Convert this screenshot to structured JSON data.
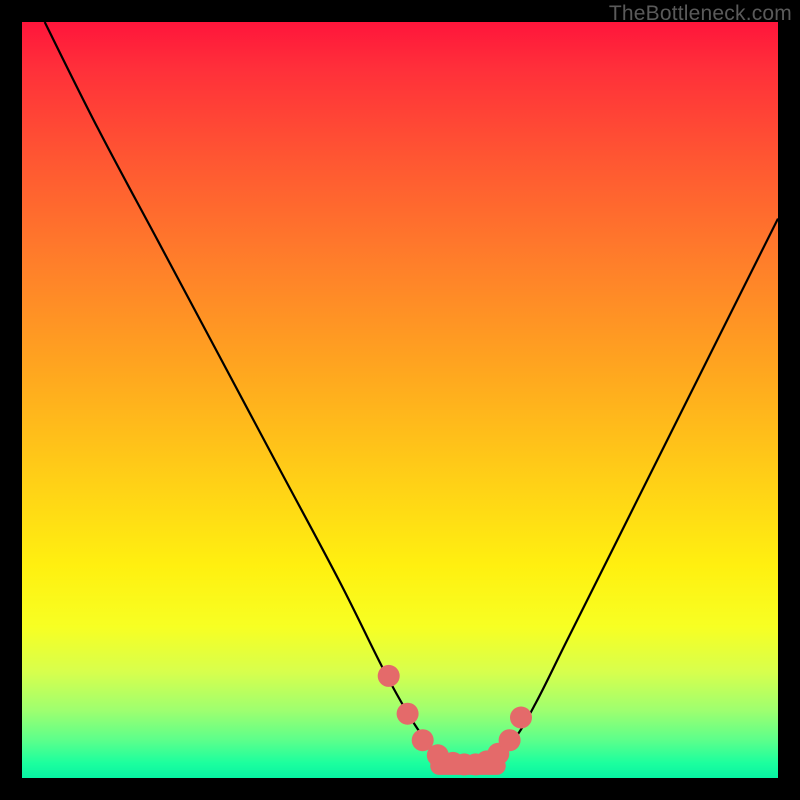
{
  "watermark": "TheBottleneck.com",
  "chart_data": {
    "type": "line",
    "title": "",
    "xlabel": "",
    "ylabel": "",
    "xlim": [
      0,
      100
    ],
    "ylim": [
      0,
      100
    ],
    "series": [
      {
        "name": "bottleneck-curve",
        "x": [
          3,
          10,
          18,
          26,
          34,
          42,
          48,
          52,
          55,
          57,
          59,
          62,
          65,
          68,
          72,
          78,
          85,
          92,
          100
        ],
        "y": [
          100,
          86,
          71,
          56,
          41,
          26,
          14,
          7,
          3,
          1.5,
          1.5,
          2.5,
          5,
          10,
          18,
          30,
          44,
          58,
          74
        ]
      }
    ],
    "markers": {
      "name": "highlight-dots",
      "color": "#e46a6a",
      "points_x": [
        48.5,
        51,
        53,
        55,
        57,
        58.5,
        60,
        61.5,
        63,
        64.5,
        66
      ],
      "points_y": [
        13.5,
        8.5,
        5,
        3,
        2,
        1.8,
        1.8,
        2.2,
        3.2,
        5,
        8
      ]
    },
    "background_gradient": {
      "top": "#ff153b",
      "mid1": "#ff7f2a",
      "mid2": "#fff010",
      "bottom": "#07f3a3"
    }
  }
}
